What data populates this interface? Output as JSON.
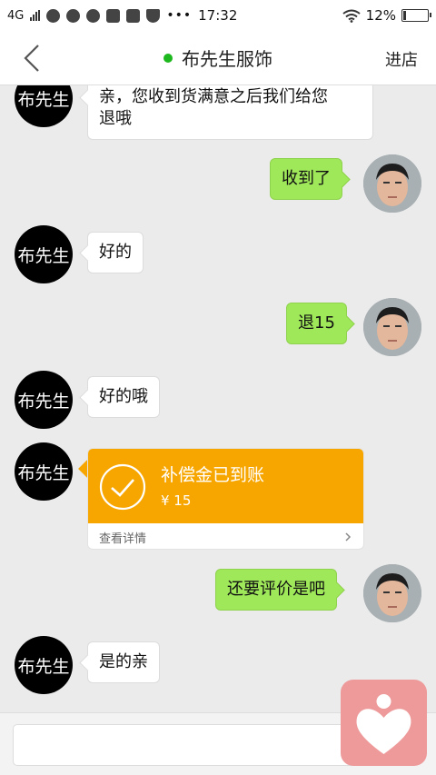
{
  "status_bar": {
    "network": "4G",
    "time": "17:32",
    "battery": "12%",
    "battery_level": 0.12
  },
  "header": {
    "title": "布先生服饰",
    "right_action": "进店",
    "online_color": "#1db81d"
  },
  "messages": [
    {
      "side": "left",
      "avatar_text": "布先生",
      "text_line1": "亲，您收到货满意之后我们给您",
      "text_line2": "退哦"
    },
    {
      "side": "right",
      "text": "收到了"
    },
    {
      "side": "left",
      "avatar_text": "布先生",
      "text": "好的"
    },
    {
      "side": "right",
      "text": "退15"
    },
    {
      "side": "left",
      "avatar_text": "布先生",
      "text": "好的哦"
    },
    {
      "side": "left",
      "avatar_text": "布先生",
      "card": {
        "title": "补偿金已到账",
        "amount": "¥ 15",
        "link": "查看详情"
      }
    },
    {
      "side": "right",
      "text": "还要评价是吧"
    },
    {
      "side": "left",
      "avatar_text": "布先生",
      "text": "是的亲"
    }
  ],
  "colors": {
    "my_bubble": "#9fe85a",
    "card": "#f7a600",
    "float_button": "#ee9a9a"
  },
  "icons": {
    "back": "back-arrow-icon",
    "check": "check-circle-icon",
    "chevron": "chevron-right-icon",
    "float": "heart-person-icon"
  }
}
